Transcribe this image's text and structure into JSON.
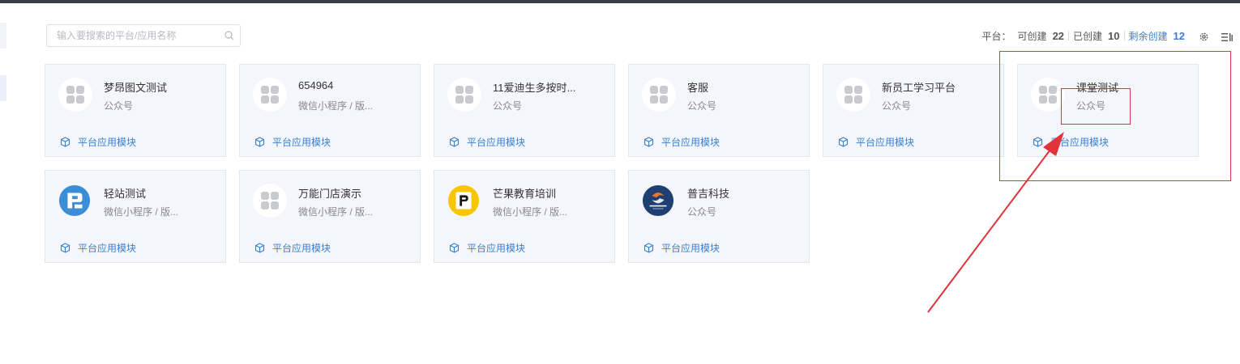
{
  "search": {
    "placeholder": "输入要搜索的平台/应用名称"
  },
  "stats": {
    "platform_label": "平台：",
    "can_create_label": "可创建",
    "can_create": "22",
    "created_label": "已创建",
    "created": "10",
    "remaining_label": "剩余创建",
    "remaining": "12"
  },
  "colors": {
    "accent": "#3a7fd5",
    "annotation": "#e0343a",
    "card_bg": "#f5f6fc"
  },
  "cards": [
    {
      "name": "梦昂图文测试",
      "type": "公众号",
      "link": "平台应用模块",
      "logo": "placeholder-grid-icon"
    },
    {
      "name": "654964",
      "type": "微信小程序 / 版...",
      "link": "平台应用模块",
      "logo": "placeholder-grid-icon"
    },
    {
      "name": "11爱迪生多按时...",
      "type": "公众号",
      "link": "平台应用模块",
      "logo": "placeholder-grid-icon"
    },
    {
      "name": "客服",
      "type": "公众号",
      "link": "平台应用模块",
      "logo": "placeholder-grid-icon"
    },
    {
      "name": "新员工学习平台",
      "type": "公众号",
      "link": "平台应用模块",
      "logo": "placeholder-grid-icon"
    },
    {
      "name": "课堂测试",
      "type": "公众号",
      "link": "平台应用模块",
      "logo": "placeholder-grid-icon"
    },
    {
      "name": "轻站测试",
      "type": "微信小程序 / 版...",
      "link": "平台应用模块",
      "logo": "blue-brand-logo"
    },
    {
      "name": "万能门店演示",
      "type": "微信小程序 / 版...",
      "link": "平台应用模块",
      "logo": "placeholder-grid-icon"
    },
    {
      "name": "芒果教育培训",
      "type": "微信小程序 / 版...",
      "link": "平台应用模块",
      "logo": "yellow-p-logo"
    },
    {
      "name": "普吉科技",
      "type": "公众号",
      "link": "平台应用模块",
      "logo": "pujikeji-logo"
    }
  ]
}
